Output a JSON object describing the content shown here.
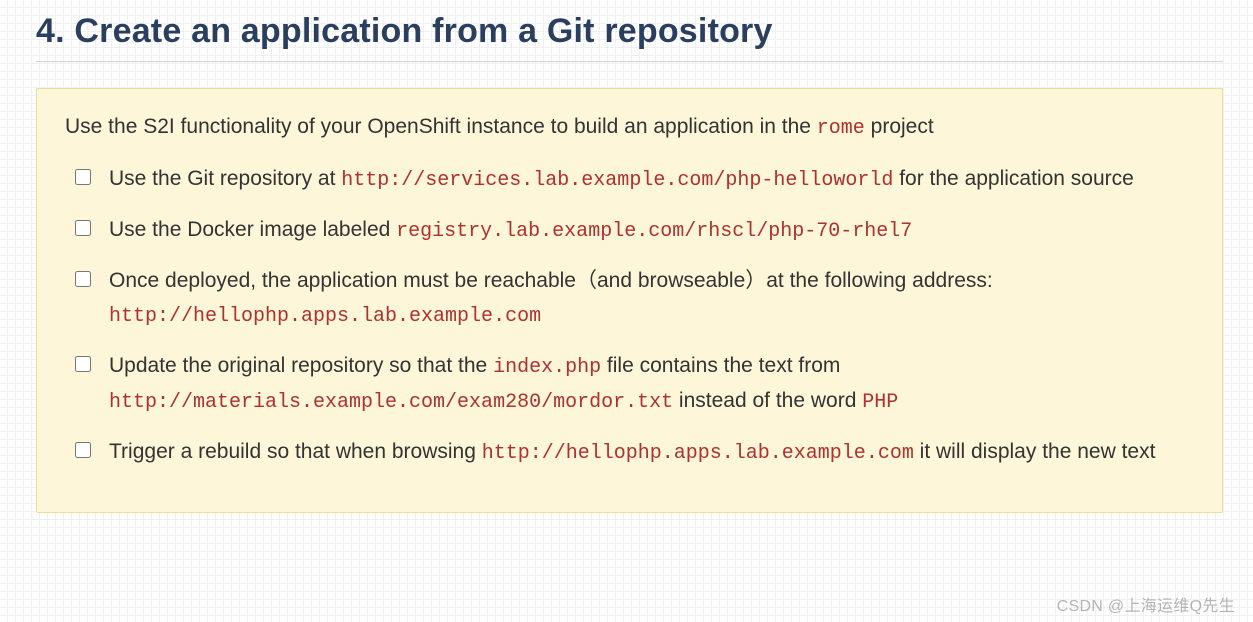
{
  "heading": "4. Create an application from a Git repository",
  "intro": {
    "pre": "Use the S2I functionality of your OpenShift instance to build an application in the ",
    "code": "rome",
    "post": " project"
  },
  "tasks": [
    {
      "segments": [
        {
          "t": "text",
          "v": "Use the Git repository at "
        },
        {
          "t": "code",
          "v": "http://services.lab.example.com/php-helloworld"
        },
        {
          "t": "text",
          "v": " for the application source"
        }
      ]
    },
    {
      "segments": [
        {
          "t": "text",
          "v": "Use the Docker image labeled "
        },
        {
          "t": "code",
          "v": "registry.lab.example.com/rhscl/php-70-rhel7"
        }
      ]
    },
    {
      "segments": [
        {
          "t": "text",
          "v": "Once deployed, the application must be reachable（and browseable）at the following address: "
        },
        {
          "t": "code",
          "v": "http://hellophp.apps.lab.example.com"
        }
      ]
    },
    {
      "segments": [
        {
          "t": "text",
          "v": "Update the original repository so that the "
        },
        {
          "t": "code",
          "v": "index.php"
        },
        {
          "t": "text",
          "v": " file contains the text from "
        },
        {
          "t": "code",
          "v": "http://materials.example.com/exam280/mordor.txt"
        },
        {
          "t": "text",
          "v": " instead of the word "
        },
        {
          "t": "code",
          "v": "PHP"
        }
      ]
    },
    {
      "segments": [
        {
          "t": "text",
          "v": "Trigger a rebuild so that when browsing "
        },
        {
          "t": "code",
          "v": "http://hellophp.apps.lab.example.com"
        },
        {
          "t": "text",
          "v": " it will display the new text"
        }
      ]
    }
  ],
  "watermark": "CSDN @上海运维Q先生"
}
